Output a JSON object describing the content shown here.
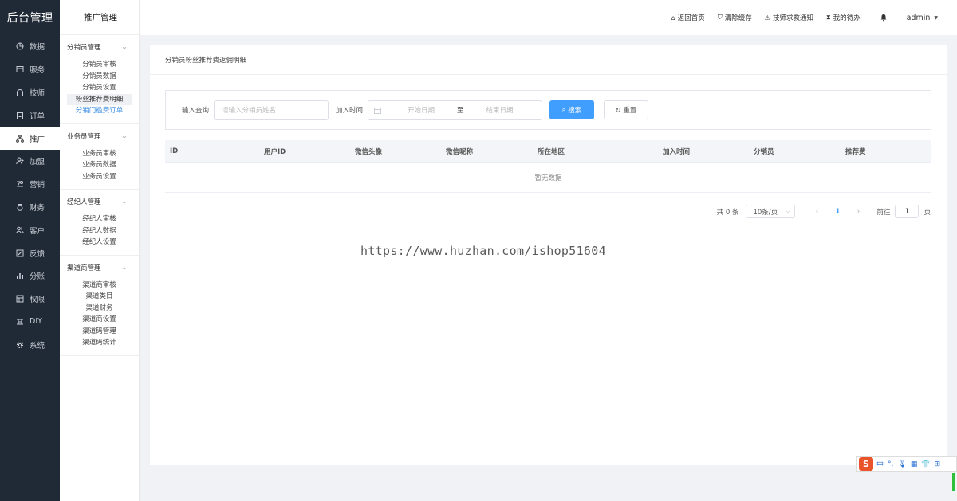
{
  "brand": "后台管理",
  "nav1": [
    {
      "label": "数据",
      "icon": "pie-chart-icon"
    },
    {
      "label": "服务",
      "icon": "calendar-icon"
    },
    {
      "label": "技师",
      "icon": "headset-icon"
    },
    {
      "label": "订单",
      "icon": "clipboard-icon"
    },
    {
      "label": "推广",
      "icon": "share-tree-icon",
      "active": true
    },
    {
      "label": "加盟",
      "icon": "user-add-icon"
    },
    {
      "label": "营销",
      "icon": "marketing-icon"
    },
    {
      "label": "财务",
      "icon": "money-bag-icon"
    },
    {
      "label": "客户",
      "icon": "users-icon"
    },
    {
      "label": "反馈",
      "icon": "edit-icon"
    },
    {
      "label": "分账",
      "icon": "bar-chart-icon"
    },
    {
      "label": "权限",
      "icon": "permission-icon"
    },
    {
      "label": "DIY",
      "icon": "diy-icon"
    },
    {
      "label": "系统",
      "icon": "gear-icon"
    }
  ],
  "nav2": {
    "head": "推广管理",
    "groups": [
      {
        "title": "分销员管理",
        "items": [
          "分销员审核",
          "分销员数据",
          "分销员设置",
          "粉丝推荐费明细",
          "分销门槛费订单"
        ]
      },
      {
        "title": "业务员管理",
        "items": [
          "业务员审核",
          "业务员数据",
          "业务员设置"
        ]
      },
      {
        "title": "经纪人管理",
        "items": [
          "经纪人审核",
          "经纪人数据",
          "经纪人设置"
        ]
      },
      {
        "title": "渠道商管理",
        "items": [
          "渠道商审核",
          "渠道类目",
          "渠道财务",
          "渠道商设置",
          "渠道码管理",
          "渠道码统计"
        ]
      }
    ]
  },
  "topbar": {
    "home": "返回首页",
    "cache": "清除缓存",
    "sos": "技师求救通知",
    "todo": "我的待办",
    "user": "admin"
  },
  "card": {
    "title": "分销员粉丝推荐费返佣明细",
    "filter": {
      "query_label": "输入查询",
      "query_placeholder": "请输入分销员姓名",
      "time_label": "加入时间",
      "start_placeholder": "开始日期",
      "range_sep": "至",
      "end_placeholder": "结束日期",
      "search": "搜索",
      "reset": "重置"
    },
    "columns": [
      "ID",
      "用户ID",
      "微信头像",
      "微信昵称",
      "所在地区",
      "加入时间",
      "分销员",
      "推荐费"
    ],
    "empty": "暂无数据",
    "pager": {
      "total": "共 0 条",
      "size": "10条/页",
      "page": "1",
      "goto": "前往",
      "goto_value": "1",
      "page_unit": "页"
    }
  },
  "watermark": "https://www.huzhan.com/ishop51604",
  "ime": {
    "logo": "S",
    "lang": "中",
    "punct": "°,"
  }
}
